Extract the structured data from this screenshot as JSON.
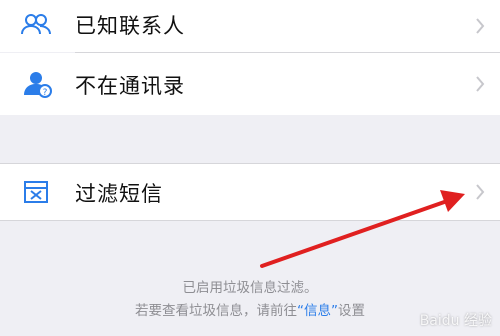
{
  "list": {
    "items": [
      {
        "label": "已知联系人",
        "icon": "contacts-icon"
      },
      {
        "label": "不在通讯录",
        "icon": "unknown-contact-icon"
      }
    ]
  },
  "filter": {
    "label": "过滤短信",
    "icon": "filter-box-icon"
  },
  "note": {
    "line1": "已启用垃圾信息过滤。",
    "line2_prefix": "若要查看垃圾信息，请前往",
    "line2_link": "“信息”",
    "line2_suffix": "设置"
  },
  "watermark": {
    "text": "Baidu 经验"
  },
  "colors": {
    "accent": "#2b7de9",
    "annotation_arrow": "#e02020"
  }
}
